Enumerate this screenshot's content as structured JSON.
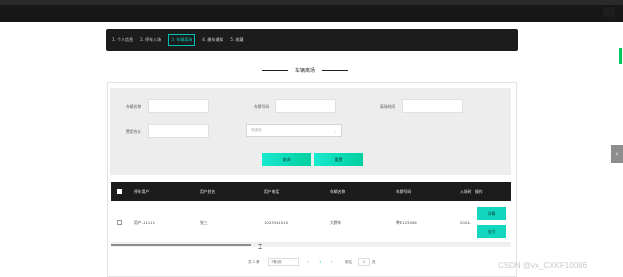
{
  "nav": {
    "steps": [
      "1. 个人信息",
      "2. 停车入场",
      "3. 车辆离场",
      "4. 缴车通知",
      "5. 收藏"
    ],
    "active_index": 2
  },
  "page_title": "车辆离场",
  "search": {
    "labels": [
      "车辆名称",
      "车牌号码",
      "离场时间",
      "费用合计",
      "支付状态"
    ],
    "status_placeholder": "请选择",
    "query_button": "查询",
    "reset_button": "重置"
  },
  "table": {
    "headers": [
      "停车用户",
      "用户姓名",
      "用户电话",
      "车辆名称",
      "车牌号码",
      "入场时",
      "操作"
    ],
    "row": {
      "user": "用户-11111",
      "name": "张三",
      "phone": "1023341010",
      "vehicle": "大野车",
      "plate": "粤E123456",
      "entry": "2024-",
      "detail_button": "详情",
      "pay_button": "支付"
    }
  },
  "pager": {
    "total": "共 1 条",
    "page_size": "7条/页",
    "prev": "‹",
    "current": "1",
    "next": "›",
    "goto_label": "前往",
    "goto_value": "1",
    "page_suffix": "页"
  },
  "watermark": "CSDN @vx_CXKF10086",
  "colors": {
    "accent": "#19e9cf",
    "header": "#1c1c1c"
  }
}
